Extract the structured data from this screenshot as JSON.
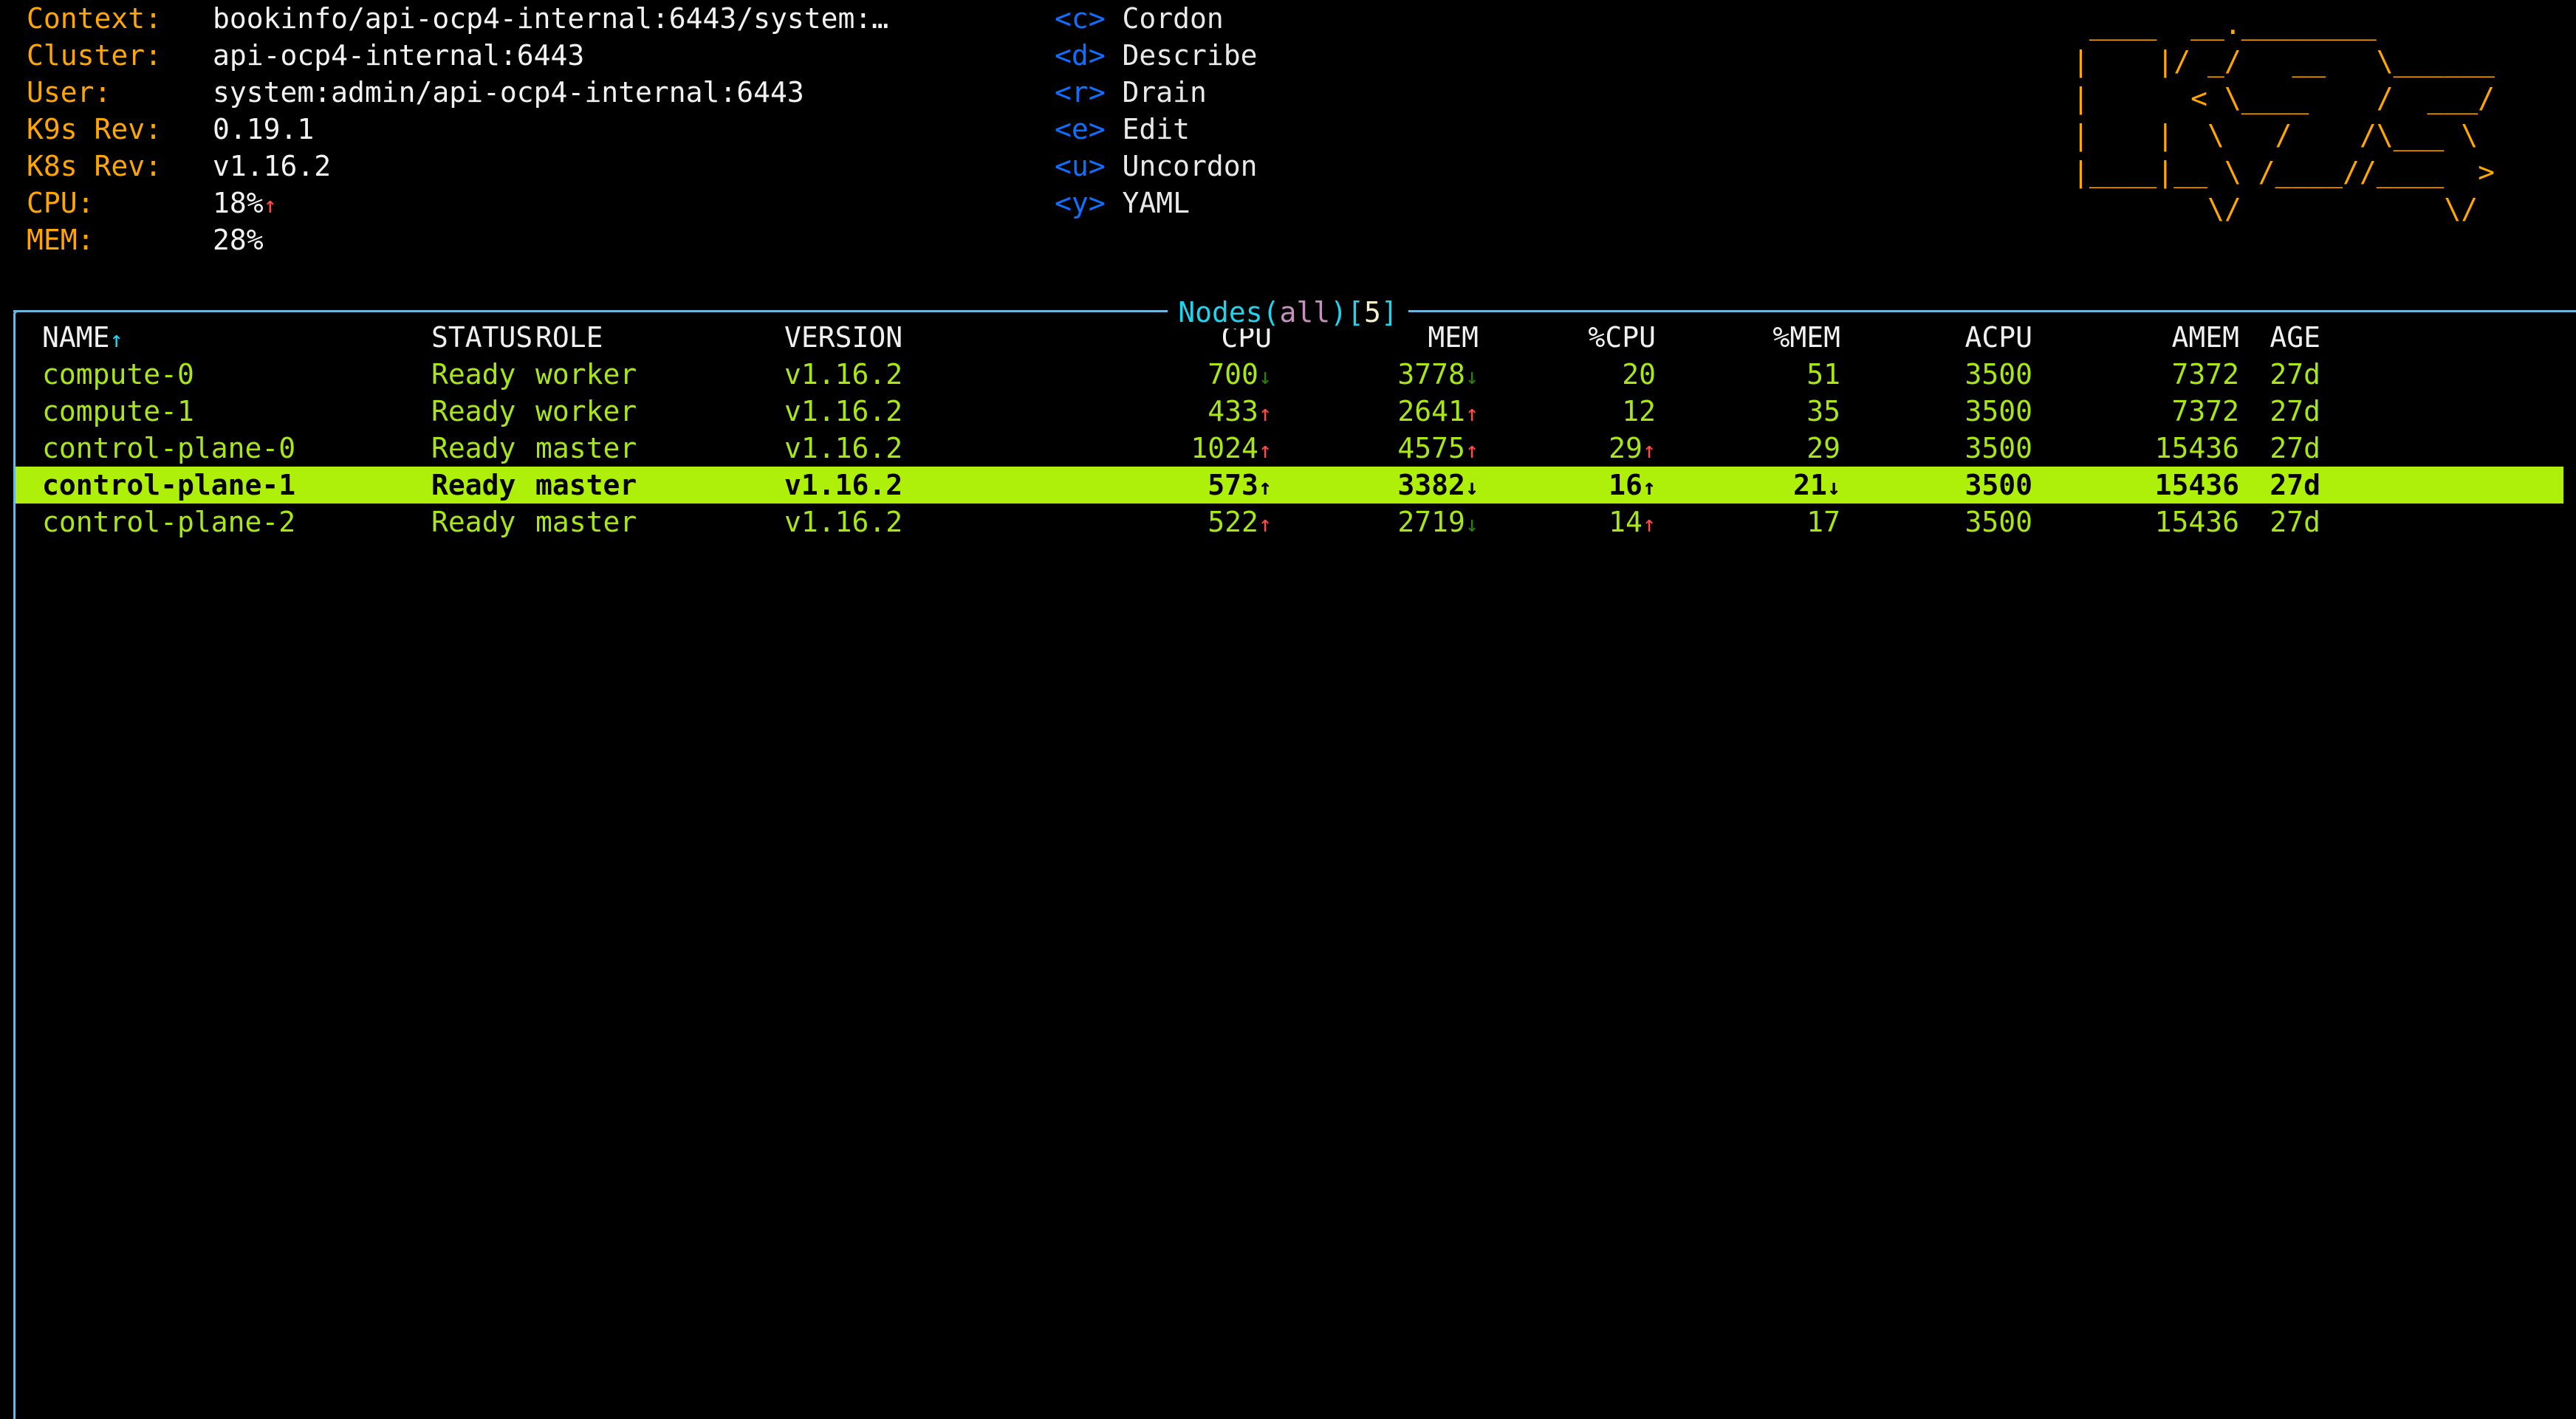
{
  "cluster_info": [
    {
      "key": "Context:",
      "value": "bookinfo/api-ocp4-internal:6443/system:…",
      "trend": ""
    },
    {
      "key": "Cluster:",
      "value": "api-ocp4-internal:6443",
      "trend": ""
    },
    {
      "key": "User:",
      "value": "system:admin/api-ocp4-internal:6443",
      "trend": ""
    },
    {
      "key": "K9s Rev:",
      "value": "0.19.1",
      "trend": ""
    },
    {
      "key": "K8s Rev:",
      "value": "v1.16.2",
      "trend": ""
    },
    {
      "key": "CPU:",
      "value": "18%",
      "trend": "↑"
    },
    {
      "key": "MEM:",
      "value": "28%",
      "trend": ""
    }
  ],
  "shortcuts": [
    {
      "key": "<c>",
      "label": "Cordon"
    },
    {
      "key": "<d>",
      "label": "Describe"
    },
    {
      "key": "<r>",
      "label": "Drain"
    },
    {
      "key": "<e>",
      "label": "Edit"
    },
    {
      "key": "<u>",
      "label": "Uncordon"
    },
    {
      "key": "<y>",
      "label": "YAML"
    }
  ],
  "logo": {
    "name": "k9s-ascii-logo",
    "color": "#ffa600",
    "lines": [
      " ____  __.________       ",
      "|    |/ _/   __   \\______",
      "|      < \\____    /  ___/",
      "|    |  \\   /    /\\___ \\ ",
      "|____|__ \\ /____//____  >",
      "        \\/            \\/ "
    ]
  },
  "panel": {
    "title_main": "Nodes",
    "title_open_paren": "(",
    "title_scope": "all",
    "title_close_paren": ")",
    "title_open_bracket": "[",
    "title_count": "5",
    "title_close_bracket": "]",
    "border_color": "#6bb7e0"
  },
  "table": {
    "sort_column": "NAME",
    "sort_arrow": "↑",
    "columns": [
      "NAME",
      "STATUS",
      "ROLE",
      "VERSION",
      "CPU",
      "MEM",
      "%CPU",
      "%MEM",
      "ACPU",
      "AMEM",
      "AGE"
    ],
    "selected_index": 3,
    "selected_bg": "#aef009",
    "row_color": "#a8e616",
    "rows": [
      {
        "name": "compute-0",
        "status": "Ready",
        "role": "worker",
        "version": "v1.16.2",
        "cpu": "700",
        "cpu_trend": "↓",
        "mem": "3778",
        "mem_trend": "↓",
        "pcpu": "20",
        "pcpu_trend": "",
        "pmem": "51",
        "pmem_trend": "",
        "acpu": "3500",
        "amem": "7372",
        "age": "27d"
      },
      {
        "name": "compute-1",
        "status": "Ready",
        "role": "worker",
        "version": "v1.16.2",
        "cpu": "433",
        "cpu_trend": "↑",
        "mem": "2641",
        "mem_trend": "↑",
        "pcpu": "12",
        "pcpu_trend": "",
        "pmem": "35",
        "pmem_trend": "",
        "acpu": "3500",
        "amem": "7372",
        "age": "27d"
      },
      {
        "name": "control-plane-0",
        "status": "Ready",
        "role": "master",
        "version": "v1.16.2",
        "cpu": "1024",
        "cpu_trend": "↑",
        "mem": "4575",
        "mem_trend": "↑",
        "pcpu": "29",
        "pcpu_trend": "↑",
        "pmem": "29",
        "pmem_trend": "",
        "acpu": "3500",
        "amem": "15436",
        "age": "27d"
      },
      {
        "name": "control-plane-1",
        "status": "Ready",
        "role": "master",
        "version": "v1.16.2",
        "cpu": "573",
        "cpu_trend": "↑",
        "mem": "3382",
        "mem_trend": "↓",
        "pcpu": "16",
        "pcpu_trend": "↑",
        "pmem": "21",
        "pmem_trend": "↓",
        "acpu": "3500",
        "amem": "15436",
        "age": "27d"
      },
      {
        "name": "control-plane-2",
        "status": "Ready",
        "role": "master",
        "version": "v1.16.2",
        "cpu": "522",
        "cpu_trend": "↑",
        "mem": "2719",
        "mem_trend": "↓",
        "pcpu": "14",
        "pcpu_trend": "↑",
        "pmem": "17",
        "pmem_trend": "",
        "acpu": "3500",
        "amem": "15436",
        "age": "27d"
      }
    ]
  }
}
